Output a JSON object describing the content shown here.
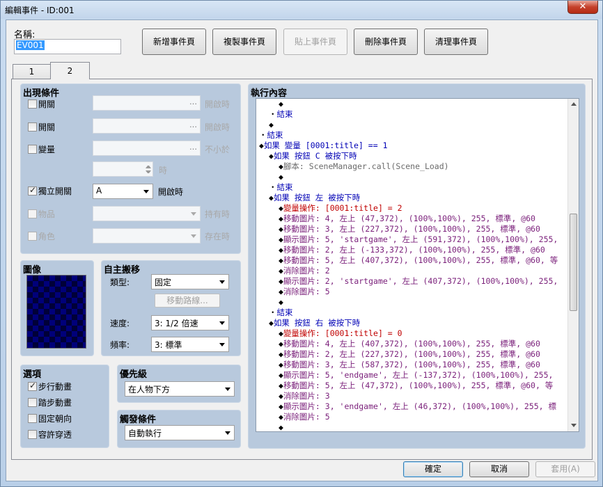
{
  "window": {
    "title": "編輯事件 - ID:001",
    "close": "✕"
  },
  "name_label": "名稱:",
  "name_value": "EV001",
  "toolbar": {
    "new_page": "新增事件頁",
    "copy_page": "複製事件頁",
    "paste_page": "貼上事件頁",
    "delete_page": "刪除事件頁",
    "clear_page": "清理事件頁"
  },
  "tabs": [
    {
      "label": "1"
    },
    {
      "label": "2"
    }
  ],
  "conditions": {
    "title": "出現條件",
    "switch1": {
      "label": "開關",
      "suffix": "開啟時",
      "checked": false
    },
    "switch2": {
      "label": "開關",
      "suffix": "開啟時",
      "checked": false
    },
    "variable": {
      "label": "變量",
      "suffix": "不小於",
      "checked": false
    },
    "variable_value_suffix": "時",
    "self_switch": {
      "label": "獨立開關",
      "value": "A",
      "suffix": "開啟時",
      "checked": true
    },
    "item": {
      "label": "物品",
      "suffix": "持有時",
      "checked": false
    },
    "actor": {
      "label": "角色",
      "suffix": "存在時",
      "checked": false
    }
  },
  "image": {
    "title": "圖像"
  },
  "autonomous": {
    "title": "自主搬移",
    "type_label": "類型:",
    "type_value": "固定",
    "route_button": "移動路線...",
    "speed_label": "速度:",
    "speed_value": "3: 1/2 倍速",
    "freq_label": "頻率:",
    "freq_value": "3: 標準"
  },
  "options": {
    "title": "選項",
    "items": [
      {
        "label": "步行動畫",
        "checked": true
      },
      {
        "label": "踏步動畫",
        "checked": false
      },
      {
        "label": "固定朝向",
        "checked": false
      },
      {
        "label": "容許穿透",
        "checked": false
      }
    ]
  },
  "priority": {
    "title": "優先級",
    "value": "在人物下方"
  },
  "trigger": {
    "title": "觸發條件",
    "value": "自動執行"
  },
  "contents": {
    "title": "執行內容",
    "lines": [
      {
        "indent": 2,
        "marker": "◆",
        "parts": []
      },
      {
        "indent": 1,
        "marker": "・",
        "parts": [
          {
            "t": "結束",
            "c": "blue"
          }
        ]
      },
      {
        "indent": 1,
        "marker": "◆",
        "parts": []
      },
      {
        "indent": 0,
        "marker": "・",
        "parts": [
          {
            "t": "結束",
            "c": "blue"
          }
        ]
      },
      {
        "indent": 0,
        "marker": "◆",
        "parts": [
          {
            "t": "如果 ",
            "c": "blue"
          },
          {
            "t": "變量 [0001:title] == 1",
            "c": "blue"
          }
        ]
      },
      {
        "indent": 1,
        "marker": "◆",
        "parts": [
          {
            "t": "如果 按鈕 C 被按下時",
            "c": "blue"
          }
        ]
      },
      {
        "indent": 2,
        "marker": "◆",
        "parts": [
          {
            "t": "腳本: SceneManager.call(Scene_Load)",
            "c": "gtxt"
          }
        ]
      },
      {
        "indent": 2,
        "marker": "◆",
        "parts": []
      },
      {
        "indent": 1,
        "marker": "・",
        "parts": [
          {
            "t": "結束",
            "c": "blue"
          }
        ]
      },
      {
        "indent": 1,
        "marker": "◆",
        "parts": [
          {
            "t": "如果 按鈕 左 被按下時",
            "c": "blue"
          }
        ]
      },
      {
        "indent": 2,
        "marker": "◆",
        "parts": [
          {
            "t": "變量操作: [0001:title] = 2",
            "c": "red"
          }
        ]
      },
      {
        "indent": 2,
        "marker": "◆",
        "parts": [
          {
            "t": "移動圖片: 4, 左上 (47,372), (100%,100%), 255, 標準, @60",
            "c": "purple"
          }
        ]
      },
      {
        "indent": 2,
        "marker": "◆",
        "parts": [
          {
            "t": "移動圖片: 3, 左上 (227,372), (100%,100%), 255, 標準, @60",
            "c": "purple"
          }
        ]
      },
      {
        "indent": 2,
        "marker": "◆",
        "parts": [
          {
            "t": "顯示圖片: 5, 'startgame', 左上 (591,372), (100%,100%), 255,",
            "c": "purple"
          }
        ]
      },
      {
        "indent": 2,
        "marker": "◆",
        "parts": [
          {
            "t": "移動圖片: 2, 左上 (-133,372), (100%,100%), 255, 標準, @60",
            "c": "purple"
          }
        ]
      },
      {
        "indent": 2,
        "marker": "◆",
        "parts": [
          {
            "t": "移動圖片: 5, 左上 (407,372), (100%,100%), 255, 標準, @60, 等",
            "c": "purple"
          }
        ]
      },
      {
        "indent": 2,
        "marker": "◆",
        "parts": [
          {
            "t": "消除圖片: 2",
            "c": "purple"
          }
        ]
      },
      {
        "indent": 2,
        "marker": "◆",
        "parts": [
          {
            "t": "顯示圖片: 2, 'startgame', 左上 (407,372), (100%,100%), 255,",
            "c": "purple"
          }
        ]
      },
      {
        "indent": 2,
        "marker": "◆",
        "parts": [
          {
            "t": "消除圖片: 5",
            "c": "purple"
          }
        ]
      },
      {
        "indent": 2,
        "marker": "◆",
        "parts": []
      },
      {
        "indent": 1,
        "marker": "・",
        "parts": [
          {
            "t": "結束",
            "c": "blue"
          }
        ]
      },
      {
        "indent": 1,
        "marker": "◆",
        "parts": [
          {
            "t": "如果 按鈕 右 被按下時",
            "c": "blue"
          }
        ]
      },
      {
        "indent": 2,
        "marker": "◆",
        "parts": [
          {
            "t": "變量操作: [0001:title] = 0",
            "c": "red"
          }
        ]
      },
      {
        "indent": 2,
        "marker": "◆",
        "parts": [
          {
            "t": "移動圖片: 4, 左上 (407,372), (100%,100%), 255, 標準, @60",
            "c": "purple"
          }
        ]
      },
      {
        "indent": 2,
        "marker": "◆",
        "parts": [
          {
            "t": "移動圖片: 2, 左上 (227,372), (100%,100%), 255, 標準, @60",
            "c": "purple"
          }
        ]
      },
      {
        "indent": 2,
        "marker": "◆",
        "parts": [
          {
            "t": "移動圖片: 3, 左上 (587,372), (100%,100%), 255, 標準, @60",
            "c": "purple"
          }
        ]
      },
      {
        "indent": 2,
        "marker": "◆",
        "parts": [
          {
            "t": "顯示圖片: 5, 'endgame', 左上 (-137,372), (100%,100%), 255,",
            "c": "purple"
          }
        ]
      },
      {
        "indent": 2,
        "marker": "◆",
        "parts": [
          {
            "t": "移動圖片: 5, 左上 (47,372), (100%,100%), 255, 標準, @60, 等",
            "c": "purple"
          }
        ]
      },
      {
        "indent": 2,
        "marker": "◆",
        "parts": [
          {
            "t": "消除圖片: 3",
            "c": "purple"
          }
        ]
      },
      {
        "indent": 2,
        "marker": "◆",
        "parts": [
          {
            "t": "顯示圖片: 3, 'endgame', 左上 (46,372), (100%,100%), 255, 標",
            "c": "purple"
          }
        ]
      },
      {
        "indent": 2,
        "marker": "◆",
        "parts": [
          {
            "t": "消除圖片: 5",
            "c": "purple"
          }
        ]
      },
      {
        "indent": 2,
        "marker": "◆",
        "parts": []
      }
    ]
  },
  "footer": {
    "ok": "確定",
    "cancel": "取消",
    "apply": "套用(A)"
  }
}
